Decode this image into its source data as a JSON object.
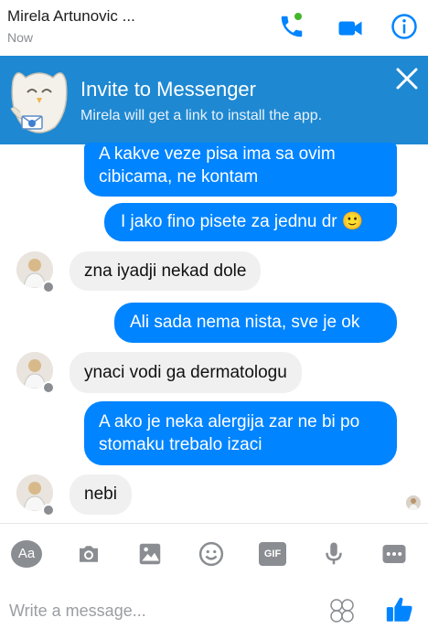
{
  "header": {
    "contact_name": "Mirela Artunovic ...",
    "status": "Now"
  },
  "banner": {
    "title": "Invite to Messenger",
    "subtitle": "Mirela will get a link to install the app."
  },
  "messages": [
    {
      "direction": "out",
      "text": "A kakve veze pisa ima sa ovim cibicama, ne kontam"
    },
    {
      "direction": "out",
      "text": "I jako fino pisete za jednu dr",
      "emoji": "🙂"
    },
    {
      "direction": "in",
      "text": "zna iyadji nekad dole"
    },
    {
      "direction": "out",
      "text": "Ali sada nema nista, sve je ok"
    },
    {
      "direction": "in",
      "text": "ynaci vodi ga dermatologu"
    },
    {
      "direction": "out",
      "text": "A ako je neka alergija zar ne bi po stomaku trebalo izaci"
    },
    {
      "direction": "in",
      "text": "nebi"
    }
  ],
  "toolbar": {
    "text_style_label": "Aa",
    "gif_label": "GIF"
  },
  "composer": {
    "placeholder": "Write a message..."
  },
  "colors": {
    "accent": "#0084ff",
    "banner": "#1e88d2",
    "online": "#42b72a",
    "incoming_bubble": "#f0f0f0"
  }
}
